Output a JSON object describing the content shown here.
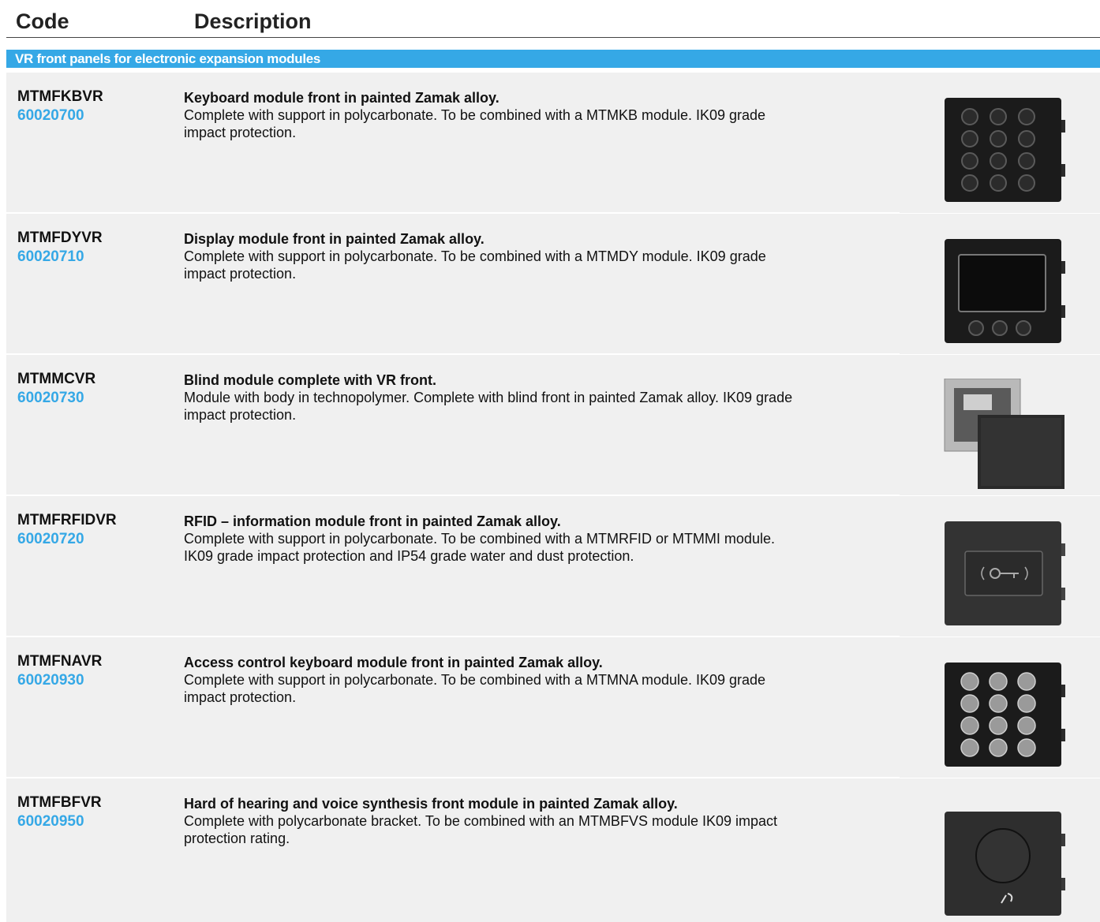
{
  "header": {
    "code_label": "Code",
    "description_label": "Description"
  },
  "section": {
    "title": "VR front panels for electronic expansion modules"
  },
  "products": [
    {
      "code": "MTMFKBVR",
      "number": "60020700",
      "title": "Keyboard module front in painted Zamak alloy.",
      "body": "Complete with support in polycarbonate. To be combined with a MTMKB module. IK09 grade impact protection.",
      "image": "keypad-front-icon"
    },
    {
      "code": "MTMFDYVR",
      "number": "60020710",
      "title": "Display module front in painted Zamak alloy.",
      "body": "Complete with support in polycarbonate. To be combined with a MTMDY module. IK09 grade impact protection.",
      "image": "display-front-icon"
    },
    {
      "code": "MTMMCVR",
      "number": "60020730",
      "title": "Blind module complete with VR front.",
      "body": "Module with body in technopolymer. Complete with blind front in painted Zamak alloy. IK09 grade impact protection.",
      "image": "blind-module-icon"
    },
    {
      "code": "MTMFRFIDVR",
      "number": "60020720",
      "title": "RFID – information module front in painted Zamak alloy.",
      "body": "Complete with support in polycarbonate. To be combined with a MTMRFID or MTMMI module. IK09 grade impact protection and IP54 grade water and dust protection.",
      "image": "rfid-front-icon"
    },
    {
      "code": "MTMFNAVR",
      "number": "60020930",
      "title": "Access control keyboard module front in painted Zamak alloy.",
      "body": "Complete with support in polycarbonate. To be combined with a MTMNA module. IK09 grade impact protection.",
      "image": "access-keypad-icon"
    },
    {
      "code": "MTMFBFVR",
      "number": "60020950",
      "title": "Hard of hearing and voice synthesis front module in painted Zamak alloy.",
      "body": "Complete with polycarbonate bracket. To be combined with an MTMBFVS module IK09 impact protection rating.",
      "image": "hearing-front-icon"
    }
  ]
}
